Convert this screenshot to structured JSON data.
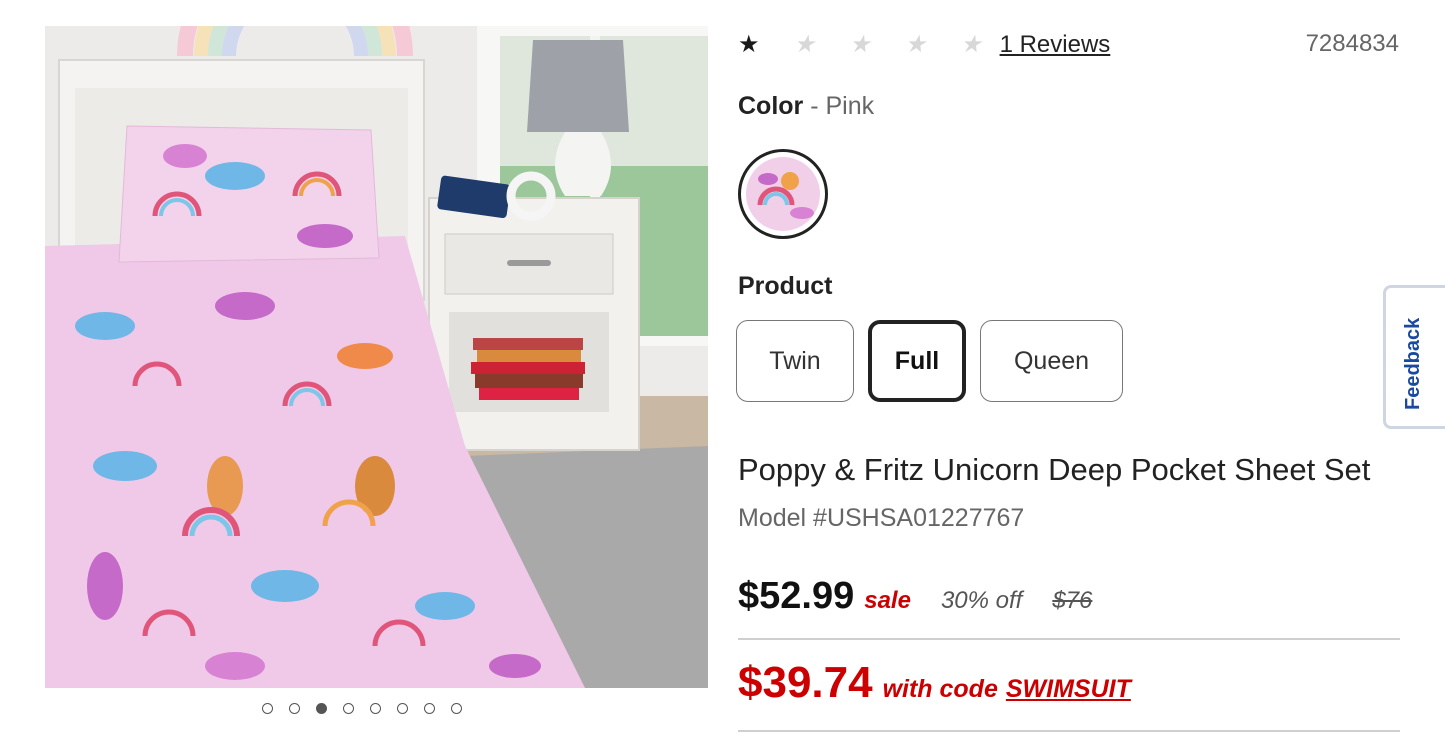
{
  "rating": {
    "stars_filled": 1,
    "stars_total": 5,
    "reviews_label": "1 Reviews"
  },
  "sku": "7284834",
  "color": {
    "label": "Color",
    "separator": " - ",
    "value": "Pink"
  },
  "product": {
    "label": "Product",
    "sizes": [
      "Twin",
      "Full",
      "Queen"
    ],
    "selected": "Full"
  },
  "title": "Poppy & Fritz Unicorn Deep Pocket Sheet Set",
  "model": "Model #USHSA01227767",
  "pricing": {
    "price": "$52.99",
    "sale_label": "sale",
    "discount": "30% off",
    "original": "$76",
    "promo_price": "$39.74",
    "promo_text": "with code",
    "promo_code": "SWIMSUIT"
  },
  "gallery": {
    "image_count": 8,
    "active_index": 2
  },
  "feedback_label": "Feedback",
  "colors": {
    "sale_red": "#cc0000",
    "feedback_blue": "#1a4aa0",
    "sheet_pink": "#f0c8e8"
  }
}
